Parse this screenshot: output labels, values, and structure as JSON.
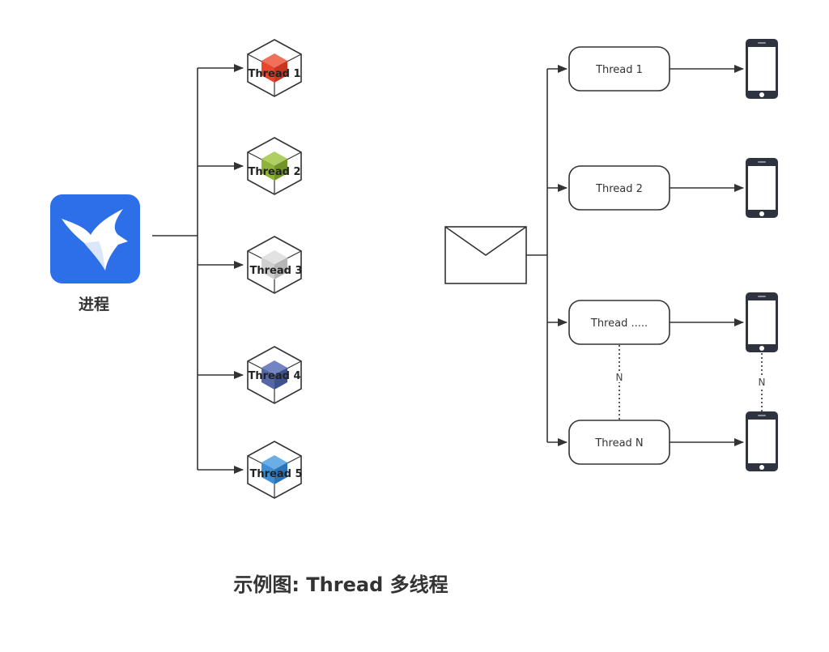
{
  "left": {
    "process_label": "进程",
    "threads": [
      {
        "label": "Thread 1",
        "color": "#E8452C"
      },
      {
        "label": "Thread 2",
        "color": "#8DB33A"
      },
      {
        "label": "Thread 3",
        "color": "#CFCFCF"
      },
      {
        "label": "Thread 4",
        "color": "#5468A8"
      },
      {
        "label": "Thread 5",
        "color": "#3B8FD6"
      }
    ]
  },
  "right": {
    "threads": [
      {
        "label": "Thread 1"
      },
      {
        "label": "Thread 2"
      },
      {
        "label": "Thread ....."
      },
      {
        "label": "Thread N"
      }
    ],
    "n_label_threads": "N",
    "n_label_phones": "N"
  },
  "caption": "示例图: Thread 多线程",
  "colors": {
    "app_icon_bg": "#2C6FE8",
    "stroke": "#333333",
    "phone_body": "#2F3340"
  }
}
